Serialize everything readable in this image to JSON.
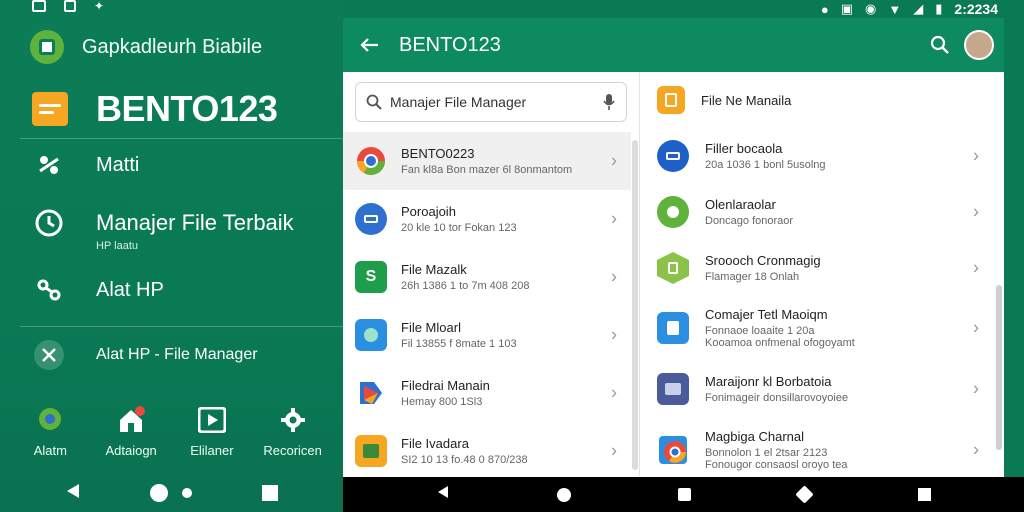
{
  "drawer": {
    "title": "Gapkadleurh Biabile",
    "brand": "BENTO123",
    "menu": [
      {
        "label": "Matti",
        "sub": ""
      },
      {
        "label": "Manajer File Terbaik",
        "sub": "HP laatu"
      },
      {
        "label": "Alat HP",
        "sub": ""
      },
      {
        "label": "Alat HP - File Manager",
        "sub": ""
      }
    ],
    "tabs": [
      {
        "label": "Alatm",
        "icon": "chat-bubble-icon"
      },
      {
        "label": "Adtaiogn",
        "icon": "home-icon"
      },
      {
        "label": "Elilaner",
        "icon": "play-icon"
      },
      {
        "label": "Recoricen",
        "icon": "gear-icon"
      }
    ]
  },
  "status": {
    "time": "2:2234"
  },
  "toolbar": {
    "title": "BENTO123"
  },
  "search": {
    "value": "Manajer File Manager"
  },
  "left_list": [
    {
      "title": "BENTO0223",
      "sub": "Fan kl8a Bon mazer 6l 8onmantom",
      "color": "#ffffff",
      "icon": "chrome-like-icon"
    },
    {
      "title": "Poroajoih",
      "sub": "20 kle 10 tor Fokan 123",
      "color": "#2f6fd0",
      "icon": "card-icon"
    },
    {
      "title": "File Mazalk",
      "sub": "26h 1386 1 to 7m 408 208",
      "color": "#1e9e4a",
      "icon": "file-s-icon"
    },
    {
      "title": "File Mloarl",
      "sub": "Fil 13855 f 8mate 1 103",
      "color": "#2a8fe0",
      "icon": "file-clock-icon"
    },
    {
      "title": "Filedrai Manain",
      "sub": "Hemay 800 1Sl3",
      "color": "#e84b3c",
      "icon": "drive-icon"
    },
    {
      "title": "File Ivadara",
      "sub": "SI2 10 13 fo.48 0 870/238",
      "color": "#f5a623",
      "icon": "file-chart-icon"
    }
  ],
  "right_list": [
    {
      "title": "File Ne Manaila",
      "sub": "",
      "color": "#f5a623",
      "icon": "document-icon"
    },
    {
      "title": "Filler bocaola",
      "sub": "20a 1036 1 bonl 5usolng",
      "color": "#1f5fc8",
      "icon": "card-icon"
    },
    {
      "title": "Olenlaraolar",
      "sub": "Doncago fonoraor",
      "color": "#5fb23b",
      "icon": "android-icon"
    },
    {
      "title": "Sroooch Cronmagig",
      "sub": "Flamager 18 Onlah",
      "color": "#8bc34a",
      "icon": "tablet-icon"
    },
    {
      "title": "Comajer Tetl Maoiqm",
      "sub": "Fonnaoe loaaite 1 20a|Kooamoa onfmenal ofogoyamt",
      "color": "#2a8fe0",
      "icon": "doc-settings-icon"
    },
    {
      "title": "Maraijonr kl Borbatoia",
      "sub": "Fonimageir donsillarovoyoiee",
      "color": "#4a5a9a",
      "icon": "folder-icon"
    },
    {
      "title": "Magbiga Charnal",
      "sub": "Bonnolon 1 el 2tsar 2123|Fonougor consaosl oroyo tea",
      "color": "#e84b3c",
      "icon": "chrome-icon"
    }
  ]
}
